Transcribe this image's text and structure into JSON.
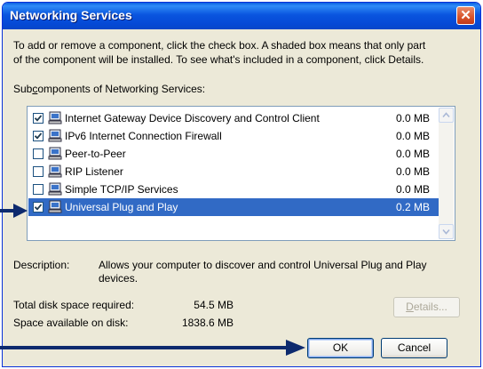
{
  "dialog": {
    "title": "Networking Services",
    "close_glyph": "✕",
    "instructions_line1": "To add or remove a component, click the check box. A shaded box means that only part",
    "instructions_line2": "of the component will be installed. To see what's included in a component, click Details.",
    "subcomponents_label_pre": "Sub",
    "subcomponents_label_accel": "c",
    "subcomponents_label_post": "omponents of Networking Services:"
  },
  "components": [
    {
      "name": "Internet Gateway Device Discovery and Control Client",
      "size": "0.0 MB",
      "checked": true,
      "selected": false
    },
    {
      "name": "IPv6 Internet Connection Firewall",
      "size": "0.0 MB",
      "checked": true,
      "selected": false
    },
    {
      "name": "Peer-to-Peer",
      "size": "0.0 MB",
      "checked": false,
      "selected": false
    },
    {
      "name": "RIP Listener",
      "size": "0.0 MB",
      "checked": false,
      "selected": false
    },
    {
      "name": "Simple TCP/IP Services",
      "size": "0.0 MB",
      "checked": false,
      "selected": false
    },
    {
      "name": "Universal Plug and Play",
      "size": "0.2 MB",
      "checked": true,
      "selected": true
    }
  ],
  "description": {
    "label": "Description:",
    "text": "Allows your computer to discover and control Universal Plug and Play devices."
  },
  "disk": {
    "required_label": "Total disk space required:",
    "required_value": "54.5 MB",
    "available_label": "Space available on disk:",
    "available_value": "1838.6 MB"
  },
  "buttons": {
    "details_accel": "D",
    "details_rest": "etails...",
    "ok": "OK",
    "cancel": "Cancel"
  },
  "icons": {
    "component": "network-component-icon",
    "checkmark": "checkmark-icon",
    "scroll_up": "scroll-up-arrow-icon",
    "scroll_down": "scroll-down-arrow-icon",
    "callout": "pointer-arrow-icon"
  },
  "colors": {
    "titlebar": "#0a55df",
    "dialog_bg": "#ece9d8",
    "selection": "#316ac5",
    "close": "#d8532a",
    "callout_arrow": "#0d2a6e"
  }
}
